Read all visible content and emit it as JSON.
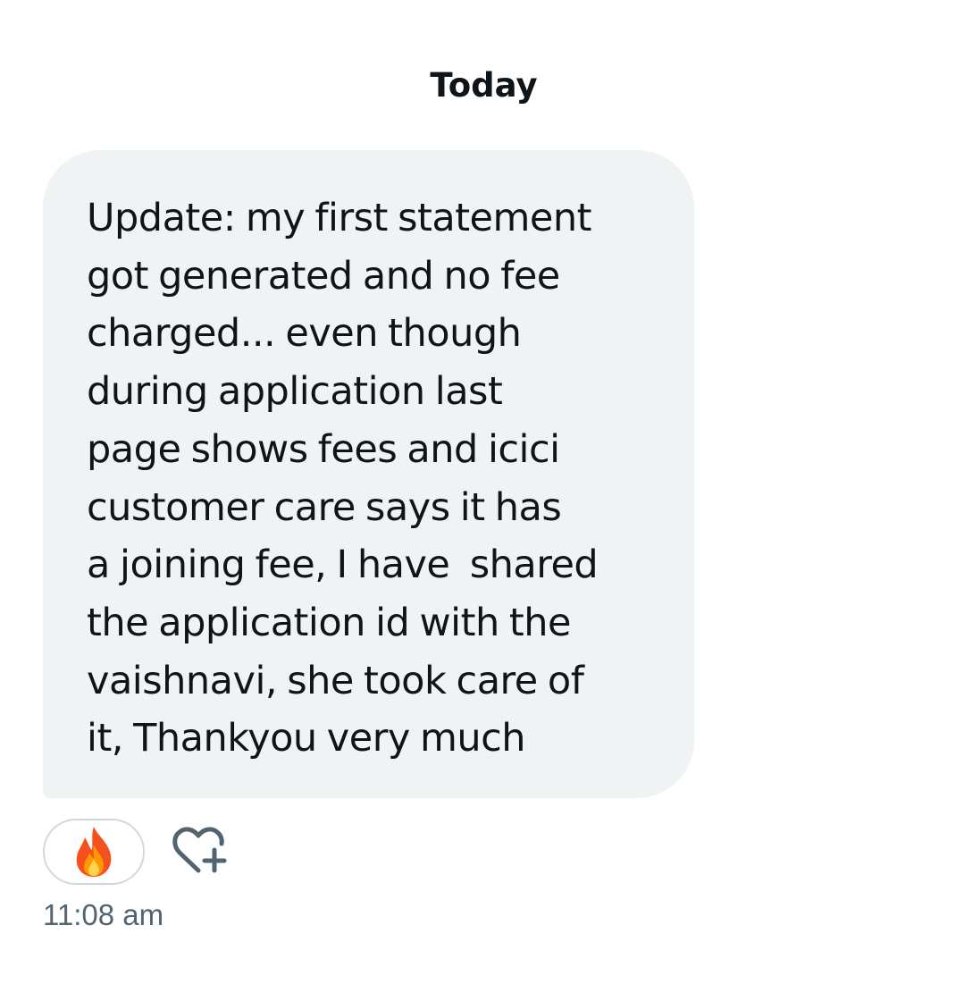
{
  "date_separator": "Today",
  "message": {
    "text": "Update: my first statement\ngot generated and no fee\ncharged... even though\nduring application last\npage shows fees and icici\ncustomer care says it has\na joining fee, I have  shared\nthe application id with the\nvaishnavi, she took care of\nit, Thankyou very much",
    "timestamp": "11:08 am",
    "reaction": {
      "icon": "fire-emoji-icon"
    },
    "add_reaction_icon": "heart-plus-icon"
  },
  "colors": {
    "bubble_background": "#eff3f4",
    "text_primary": "#0f1419",
    "text_secondary": "#536471",
    "border": "#cfd9de"
  }
}
